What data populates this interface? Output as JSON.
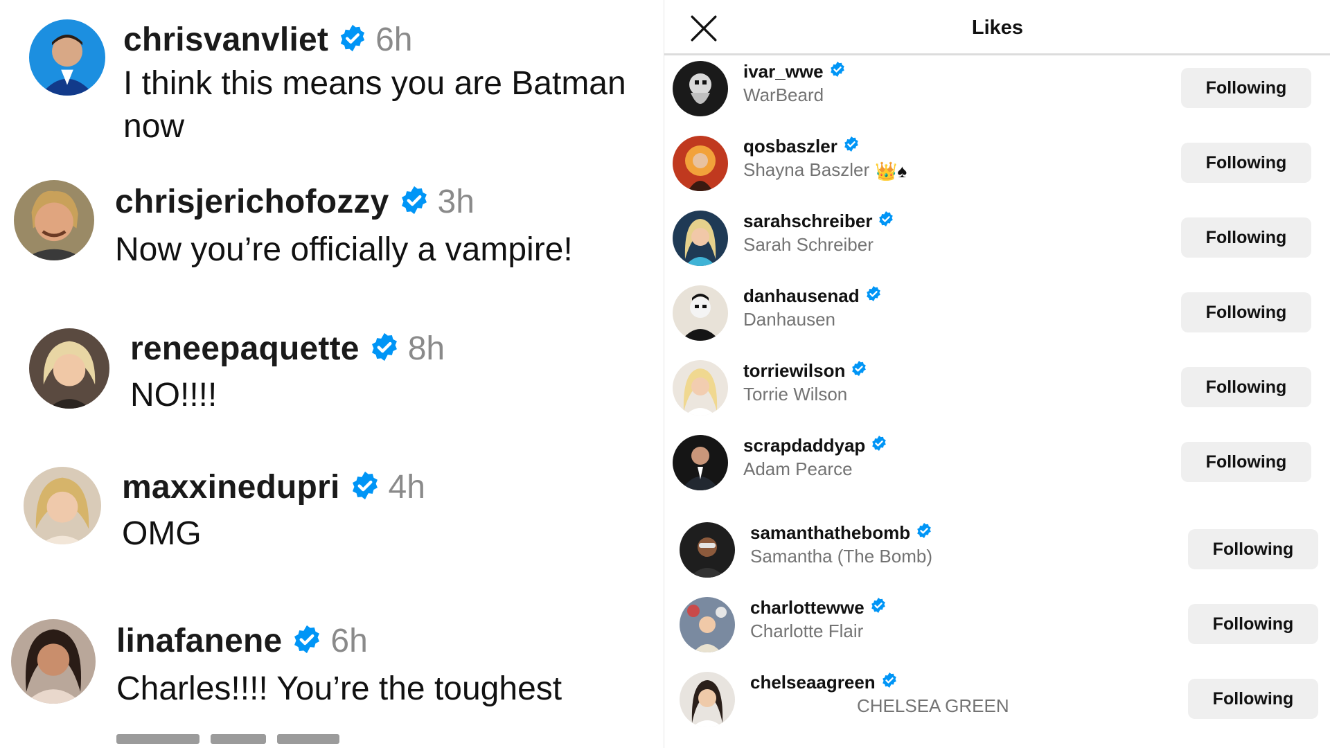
{
  "comments": [
    {
      "username": "chrisvanvliet",
      "time": "6h",
      "text": "I think this means you are Batman now"
    },
    {
      "username": "chrisjerichofozzy",
      "time": "3h",
      "text": "Now you’re officially a vampire!"
    },
    {
      "username": "reneepaquette",
      "time": "8h",
      "text": "NO!!!!"
    },
    {
      "username": "maxxinedupri",
      "time": "4h",
      "text": "OMG"
    },
    {
      "username": "linafanene",
      "time": "6h",
      "text": "Charles!!!! You’re the toughest"
    }
  ],
  "likes_panel": {
    "title": "Likes",
    "close_icon": "close-icon",
    "users": [
      {
        "username": "ivar_wwe",
        "name": "WarBeard",
        "button": "Following"
      },
      {
        "username": "qosbaszler",
        "name": "Shayna Baszler",
        "name_emoji": "👑♠",
        "button": "Following"
      },
      {
        "username": "sarahschreiber",
        "name": "Sarah Schreiber",
        "button": "Following"
      },
      {
        "username": "danhausenad",
        "name": "Danhausen",
        "button": "Following"
      },
      {
        "username": "torriewilson",
        "name": "Torrie Wilson",
        "button": "Following"
      },
      {
        "username": "scrapdaddyap",
        "name": "Adam Pearce",
        "button": "Following"
      },
      {
        "username": "samanthathebomb",
        "name": "Samantha (The Bomb)",
        "button": "Following"
      },
      {
        "username": "charlottewwe",
        "name": "Charlotte Flair",
        "button": "Following"
      },
      {
        "username": "chelseaagreen",
        "name": "CHELSEA GREEN",
        "button": "Following"
      }
    ]
  },
  "colors": {
    "verified_blue": "#0095f6",
    "button_bg": "#efefef",
    "muted_text": "#737373"
  }
}
